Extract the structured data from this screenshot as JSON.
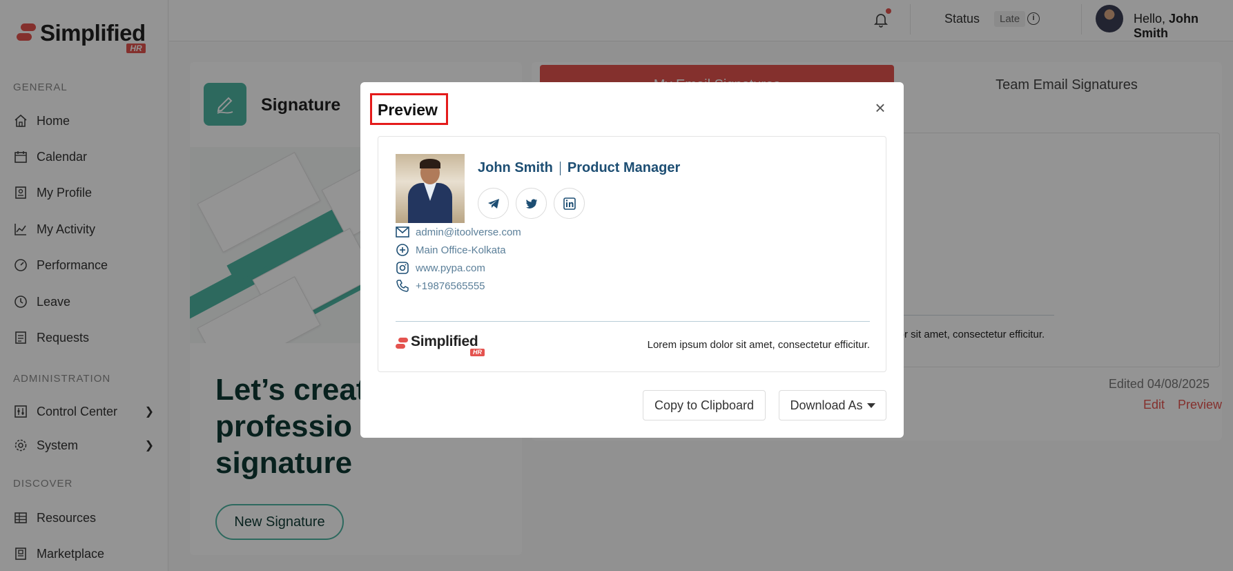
{
  "brand": {
    "name": "Simplified",
    "badge": "HR"
  },
  "sidebar": {
    "sections": [
      {
        "title": "GENERAL"
      },
      {
        "title": "ADMINISTRATION"
      },
      {
        "title": "DISCOVER"
      }
    ],
    "items": [
      {
        "label": "Home",
        "icon": "home-icon"
      },
      {
        "label": "Calendar",
        "icon": "calendar-icon"
      },
      {
        "label": "My Profile",
        "icon": "profile-icon"
      },
      {
        "label": "My Activity",
        "icon": "activity-icon"
      },
      {
        "label": "Performance",
        "icon": "performance-icon"
      },
      {
        "label": "Leave",
        "icon": "clock-icon"
      },
      {
        "label": "Requests",
        "icon": "requests-icon"
      },
      {
        "label": "Control Center",
        "icon": "sliders-icon"
      },
      {
        "label": "System",
        "icon": "gear-icon"
      },
      {
        "label": "Resources",
        "icon": "table-icon"
      },
      {
        "label": "Marketplace",
        "icon": "marketplace-icon"
      }
    ]
  },
  "header": {
    "status_label": "Status",
    "status_value": "Late",
    "greeting": "Hello, ",
    "user_name": "John Smith"
  },
  "signature_card": {
    "title": "Signature",
    "hero_line1": "Let’s creat",
    "hero_line2": "professio",
    "hero_line3": "signature",
    "new_button": "New Signature"
  },
  "tabs": {
    "mine": "My Email Signatures",
    "team": "Team Email Signatures"
  },
  "signature_list": {
    "preview_text": "olor sit amet, consectetur efficitur.",
    "edited": "Edited 04/08/2025",
    "edit_link": "Edit",
    "preview_link": "Preview"
  },
  "modal": {
    "title": "Preview",
    "name": "John Smith",
    "role": "Product Manager",
    "social": [
      "telegram-icon",
      "twitter-icon",
      "linkedin-icon"
    ],
    "email": "admin@itoolverse.com",
    "address": "Main Office-Kolkata",
    "website": "www.pypa.com",
    "phone": "+19876565555",
    "tagline": "Lorem ipsum dolor sit amet, consectetur efficitur.",
    "copy_button": "Copy to Clipboard",
    "download_button": "Download As"
  },
  "colors": {
    "accent": "#e4534f",
    "teal": "#4eb5a3",
    "signature_blue": "#1d4e73",
    "link_blue": "#5b7f99"
  }
}
